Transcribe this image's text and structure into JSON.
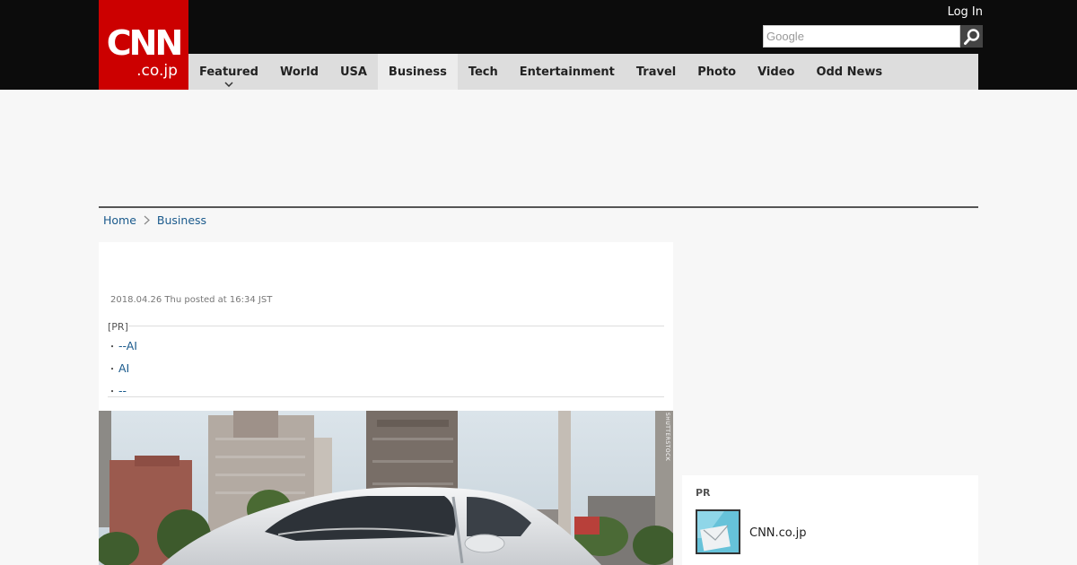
{
  "header": {
    "logo_main": "CNN",
    "logo_sub": ".co.jp",
    "login_label": "Log In",
    "search_placeholder": "Google"
  },
  "nav": {
    "items": [
      {
        "label": "Featured"
      },
      {
        "label": "World"
      },
      {
        "label": "USA"
      },
      {
        "label": "Business"
      },
      {
        "label": "Tech"
      },
      {
        "label": "Entertainment"
      },
      {
        "label": "Travel"
      },
      {
        "label": "Photo"
      },
      {
        "label": "Video"
      },
      {
        "label": "Odd News"
      }
    ],
    "active": "Business"
  },
  "breadcrumb": {
    "items": [
      "Home",
      "Business"
    ]
  },
  "article": {
    "posted": "2018.04.26 Thu posted at 16:34 JST",
    "pr_tag": "[PR]",
    "pr_bullet": "・",
    "pr_links": [
      "--AI",
      "AI",
      "--"
    ],
    "photo_credit": "SHUTTERSTOCK"
  },
  "side_pr": {
    "label": "PR",
    "text": "CNN.co.jp"
  },
  "colors": {
    "brand_red": "#cc0000",
    "topbar": "#0c0c0c",
    "nav_bg": "#dddddd",
    "link": "#1a5a8c"
  }
}
